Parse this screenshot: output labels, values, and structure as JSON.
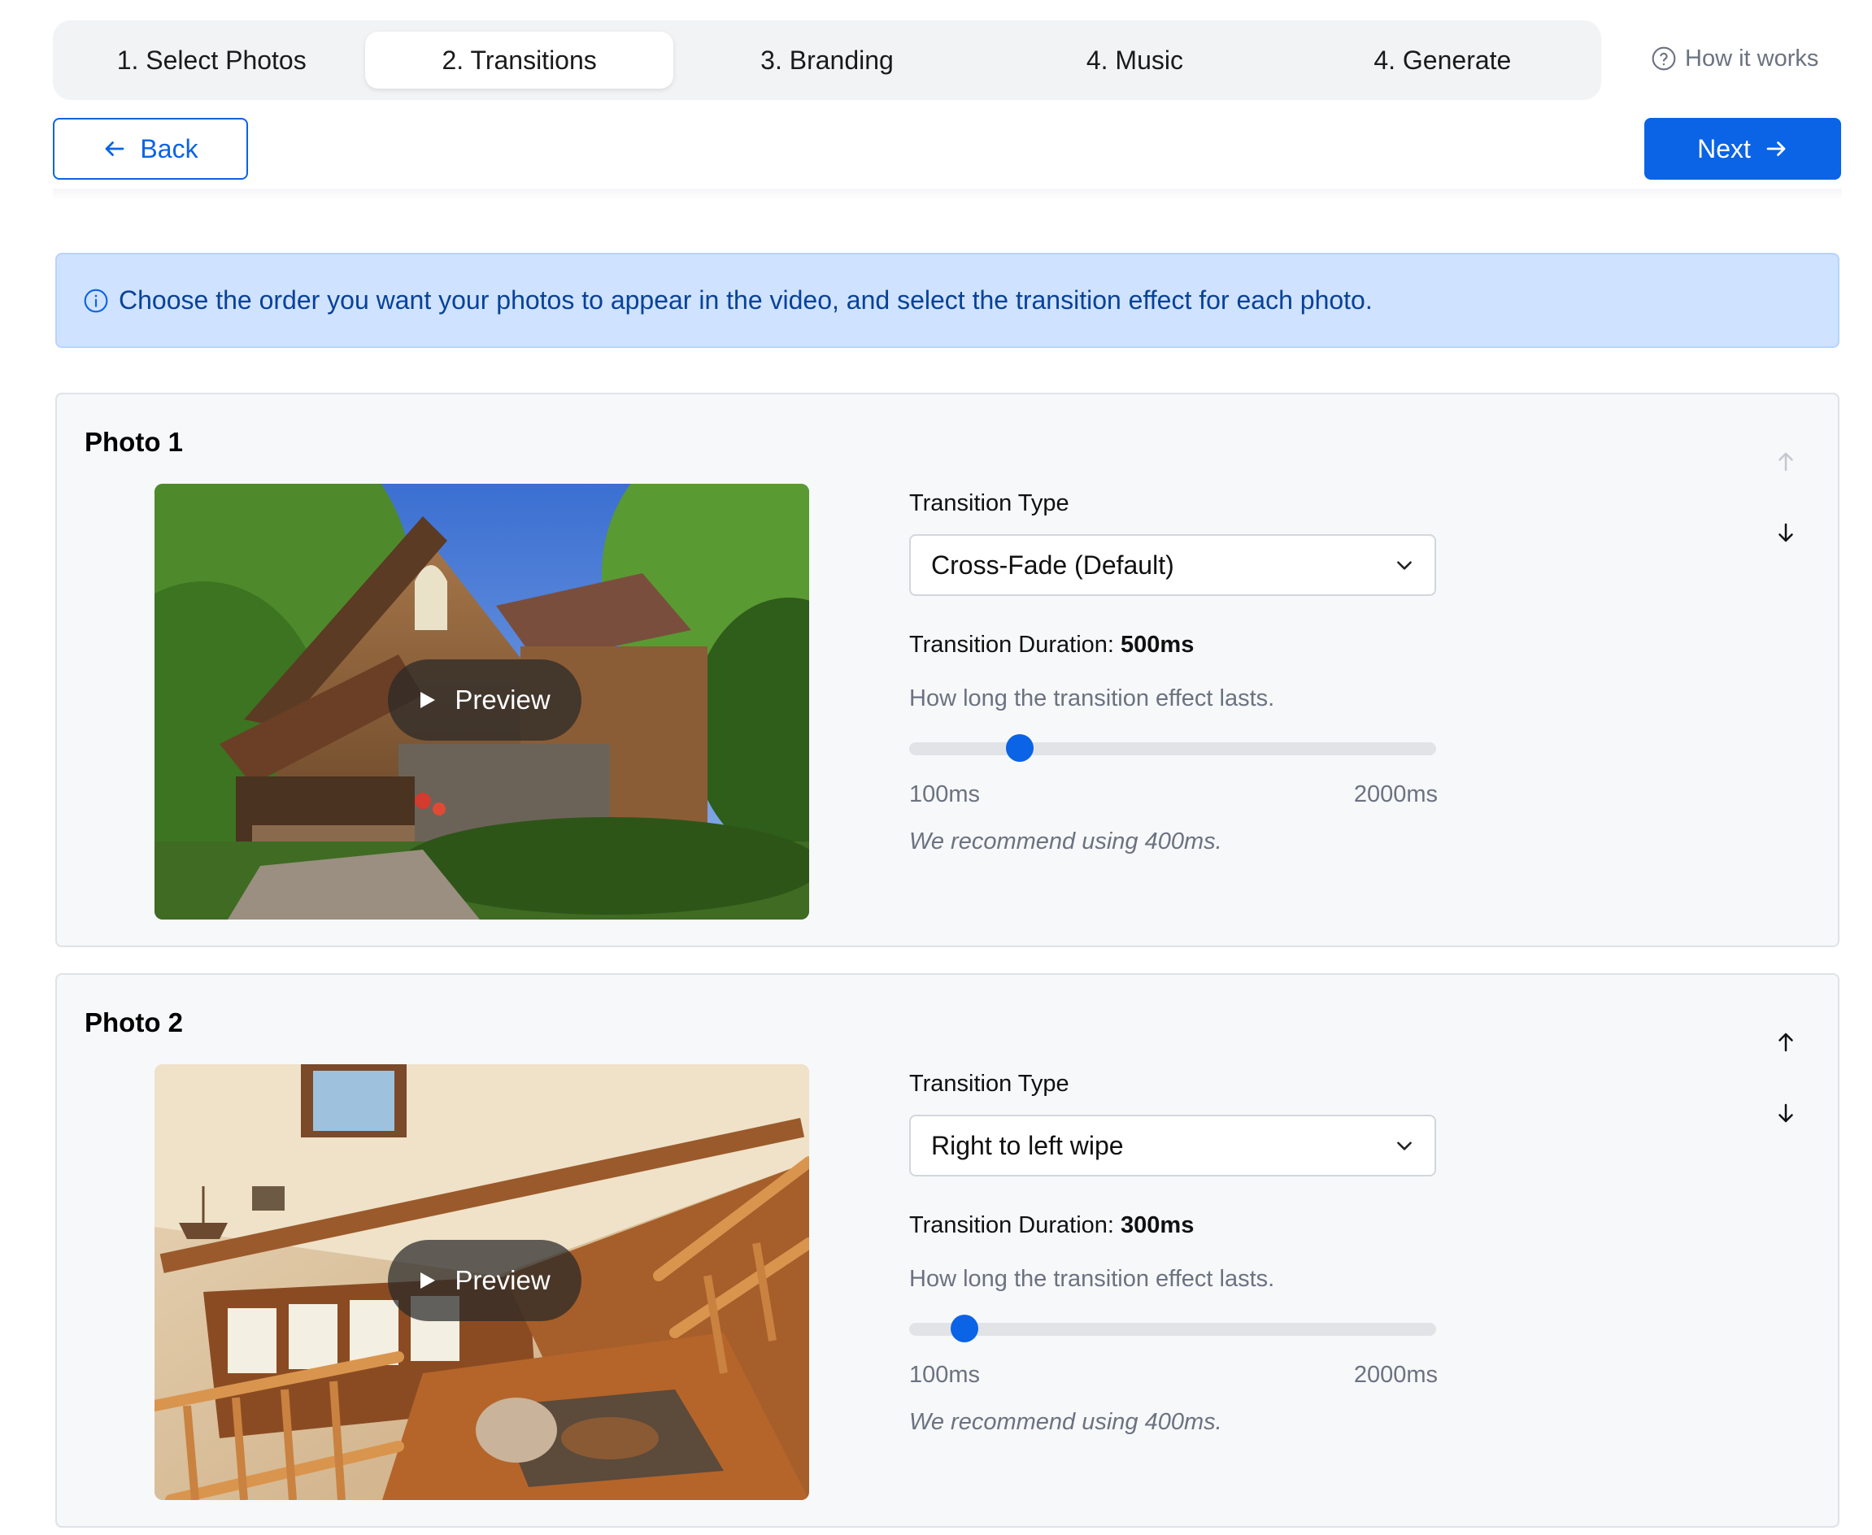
{
  "steps": [
    {
      "label": "1. Select Photos",
      "active": false
    },
    {
      "label": "2. Transitions",
      "active": true
    },
    {
      "label": "3. Branding",
      "active": false
    },
    {
      "label": "4. Music",
      "active": false
    },
    {
      "label": "4. Generate",
      "active": false
    }
  ],
  "how_it_works": "How it works",
  "nav": {
    "back_label": "Back",
    "next_label": "Next"
  },
  "info_text": "Choose the order you want your photos to appear in the video, and select the transition effect for each photo.",
  "photos": [
    {
      "title": "Photo 1",
      "image": "house-exterior-photo",
      "preview_label": "Preview",
      "transition_type_label": "Transition Type",
      "transition_type": "Cross-Fade (Default)",
      "duration_label": "Transition Duration:",
      "duration_value": "500ms",
      "duration_help": "How long the transition effect lasts.",
      "slider_min": "100ms",
      "slider_max": "2000ms",
      "slider_value_ms": 500,
      "recommendation": "We recommend using 400ms.",
      "move_up_enabled": false,
      "move_down_enabled": true
    },
    {
      "title": "Photo 2",
      "image": "log-cabin-interior-photo",
      "preview_label": "Preview",
      "transition_type_label": "Transition Type",
      "transition_type": "Right to left wipe",
      "duration_label": "Transition Duration:",
      "duration_value": "300ms",
      "duration_help": "How long the transition effect lasts.",
      "slider_min": "100ms",
      "slider_max": "2000ms",
      "slider_value_ms": 300,
      "recommendation": "We recommend using 400ms.",
      "move_up_enabled": true,
      "move_down_enabled": true
    }
  ],
  "colors": {
    "accent": "#0b63e5",
    "info_bg": "#cfe2ff",
    "info_text": "#084298",
    "disabled_arrow": "#c4c8ce"
  }
}
